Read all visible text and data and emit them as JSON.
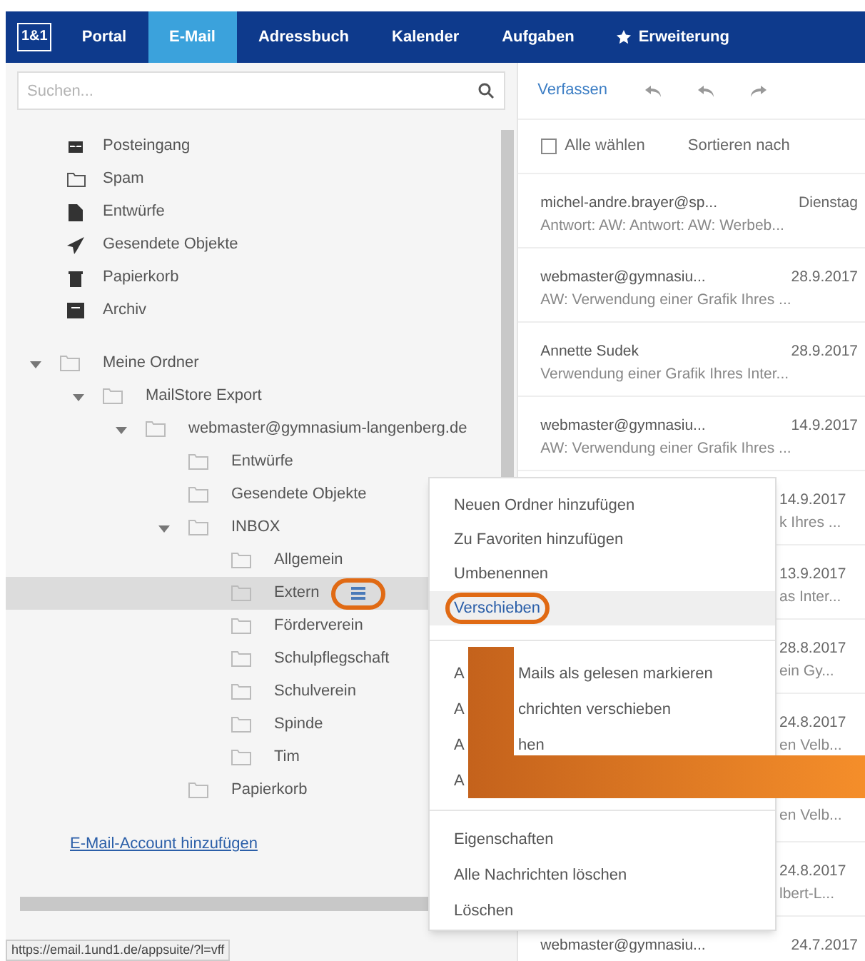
{
  "nav": {
    "logo": "1&1",
    "tabs": [
      {
        "label": "Portal",
        "selected": false
      },
      {
        "label": "E-Mail",
        "selected": true
      },
      {
        "label": "Adressbuch",
        "selected": false
      },
      {
        "label": "Kalender",
        "selected": false
      },
      {
        "label": "Aufgaben",
        "selected": false
      },
      {
        "label": "Erweiterung",
        "selected": false,
        "kind": "star"
      }
    ]
  },
  "search": {
    "placeholder": "Suchen..."
  },
  "special_folders": [
    {
      "label": "Posteingang",
      "kind": "inbox"
    },
    {
      "label": "Spam",
      "kind": "folder"
    },
    {
      "label": "Entwürfe",
      "kind": "draft"
    },
    {
      "label": "Gesendete Objekte",
      "kind": "sent"
    },
    {
      "label": "Papierkorb",
      "kind": "trash"
    },
    {
      "label": "Archiv",
      "kind": "archive"
    }
  ],
  "my_folders": [
    {
      "label": "Meine Ordner",
      "expanded": true,
      "selected": false,
      "children": [
        {
          "label": "MailStore Export",
          "expanded": true,
          "selected": false,
          "children": [
            {
              "label": "webmaster@gymnasium-langenberg.de",
              "expanded": true,
              "selected": false,
              "children": [
                {
                  "label": "Entwürfe",
                  "selected": false
                },
                {
                  "label": "Gesendete Objekte",
                  "selected": false
                },
                {
                  "label": "INBOX",
                  "expanded": true,
                  "selected": false,
                  "children": [
                    {
                      "label": "Allgemein",
                      "selected": false
                    },
                    {
                      "label": "Extern",
                      "selected": true
                    },
                    {
                      "label": "Förderverein",
                      "selected": false
                    },
                    {
                      "label": "Schulpflegschaft",
                      "selected": false
                    },
                    {
                      "label": "Schulverein",
                      "selected": false
                    },
                    {
                      "label": "Spinde",
                      "selected": false
                    },
                    {
                      "label": "Tim",
                      "selected": false
                    }
                  ]
                },
                {
                  "label": "Papierkorb",
                  "selected": false
                }
              ]
            }
          ]
        }
      ]
    }
  ],
  "add_account_link": "E-Mail-Account hinzufügen",
  "status_url": "https://email.1und1.de/appsuite/?l=vff",
  "toolbar": {
    "compose": "Verfassen"
  },
  "list_header": {
    "select_all": "Alle wählen",
    "checked": false,
    "sort": "Sortieren nach"
  },
  "messages": [
    {
      "kind": "full",
      "from": "michel-andre.brayer@sp...",
      "date": "Dienstag",
      "subject": "Antwort: AW: Antwort: AW: Werbeb..."
    },
    {
      "kind": "full",
      "from": "webmaster@gymnasiu...",
      "date": "28.9.2017",
      "subject": "AW: Verwendung einer Grafik Ihres ..."
    },
    {
      "kind": "full",
      "from": "Annette Sudek",
      "date": "28.9.2017",
      "subject": "Verwendung einer Grafik Ihres Inter..."
    },
    {
      "kind": "full",
      "from": "webmaster@gymnasiu...",
      "date": "14.9.2017",
      "subject": "AW: Verwendung einer Grafik Ihres ..."
    },
    {
      "kind": "partial",
      "date": "14.9.2017",
      "subject": "k Ihres ..."
    },
    {
      "kind": "partial",
      "date": "13.9.2017",
      "subject": "as Inter..."
    },
    {
      "kind": "partial",
      "date": "28.8.2017",
      "subject": "ein Gy..."
    },
    {
      "kind": "partial",
      "date": "24.8.2017",
      "subject": "en Velb..."
    },
    {
      "kind": "partial",
      "subject": "en Velb..."
    },
    {
      "kind": "partial",
      "date": "24.8.2017",
      "subject": "lbert-L..."
    },
    {
      "kind": "full",
      "from": "webmaster@gymnasiu...",
      "date": "24.7.2017"
    }
  ],
  "context_menu": {
    "groups": [
      [
        {
          "parts": [
            "Neuen Ordner hinzufügen"
          ],
          "selected": false
        },
        {
          "parts": [
            "Zu Favoriten hinzufügen"
          ],
          "selected": false
        },
        {
          "parts": [
            "Umbenennen"
          ],
          "selected": false
        },
        {
          "parts": [
            "Verschieben"
          ],
          "selected": true
        }
      ],
      [
        {
          "parts": [
            "A",
            "Mails als gelesen markieren"
          ],
          "selected": false
        },
        {
          "parts": [
            "A",
            "chrichten verschieben"
          ],
          "selected": false
        },
        {
          "parts": [
            "A",
            "hen"
          ],
          "selected": false
        },
        {
          "parts": [
            "A"
          ],
          "selected": false
        }
      ],
      [
        {
          "parts": [
            "Eigenschaften"
          ],
          "selected": false
        },
        {
          "parts": [
            "Alle Nachrichten löschen"
          ],
          "selected": false
        },
        {
          "parts": [
            "Löschen"
          ],
          "selected": false
        }
      ]
    ]
  }
}
